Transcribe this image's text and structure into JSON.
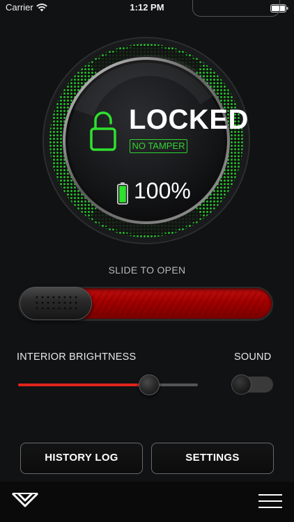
{
  "status_bar": {
    "carrier": "Carrier",
    "time": "1:12 PM"
  },
  "lock": {
    "status": "LOCKED",
    "tamper": "NO TAMPER",
    "battery_percent": "100%",
    "battery_level": 1.0,
    "accent_color": "#2fd42f"
  },
  "slide": {
    "label": "SLIDE TO OPEN",
    "track_color": "#b10b0b"
  },
  "controls": {
    "brightness_label": "INTERIOR BRIGHTNESS",
    "brightness_value": 0.73,
    "brightness_color": "#e0241c",
    "sound_label": "SOUND",
    "sound_on": false
  },
  "buttons": {
    "history": "HISTORY LOG",
    "settings": "SETTINGS"
  },
  "icons": {
    "wifi": "wifi-icon",
    "battery": "battery-icon",
    "lock": "padlock-open-icon",
    "brand": "brand-logo-icon",
    "menu": "hamburger-menu-icon"
  }
}
